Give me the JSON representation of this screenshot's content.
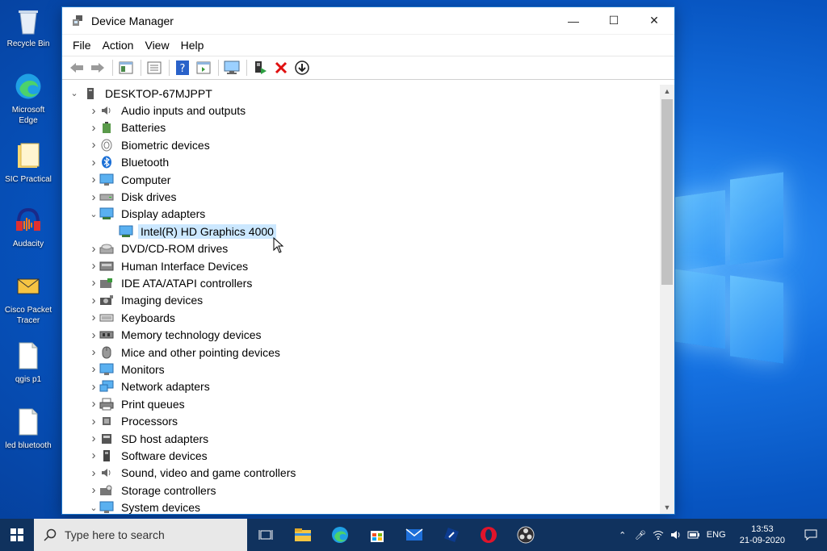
{
  "window": {
    "title": "Device Manager",
    "minimize": "—",
    "maximize": "☐",
    "close": "✕"
  },
  "menu": [
    "File",
    "Action",
    "View",
    "Help"
  ],
  "tree": {
    "root": "DESKTOP-67MJPPT",
    "items": [
      {
        "label": "Audio inputs and outputs",
        "icon": "speaker-icon",
        "expanded": false
      },
      {
        "label": "Batteries",
        "icon": "battery-icon",
        "expanded": false
      },
      {
        "label": "Biometric devices",
        "icon": "fingerprint-icon",
        "expanded": false
      },
      {
        "label": "Bluetooth",
        "icon": "bluetooth-icon",
        "expanded": false
      },
      {
        "label": "Computer",
        "icon": "computer-icon",
        "expanded": false
      },
      {
        "label": "Disk drives",
        "icon": "disk-drive-icon",
        "expanded": false
      },
      {
        "label": "Display adapters",
        "icon": "display-adapter-icon",
        "expanded": true,
        "children": [
          {
            "label": "Intel(R) HD Graphics 4000",
            "icon": "display-adapter-icon",
            "selected": true
          }
        ]
      },
      {
        "label": "DVD/CD-ROM drives",
        "icon": "dvd-icon",
        "expanded": false
      },
      {
        "label": "Human Interface Devices",
        "icon": "hid-icon",
        "expanded": false
      },
      {
        "label": "IDE ATA/ATAPI controllers",
        "icon": "ide-controller-icon",
        "expanded": false
      },
      {
        "label": "Imaging devices",
        "icon": "camera-icon",
        "expanded": false
      },
      {
        "label": "Keyboards",
        "icon": "keyboard-icon",
        "expanded": false
      },
      {
        "label": "Memory technology devices",
        "icon": "memory-icon",
        "expanded": false
      },
      {
        "label": "Mice and other pointing devices",
        "icon": "mouse-icon",
        "expanded": false
      },
      {
        "label": "Monitors",
        "icon": "monitor-icon",
        "expanded": false
      },
      {
        "label": "Network adapters",
        "icon": "network-adapter-icon",
        "expanded": false
      },
      {
        "label": "Print queues",
        "icon": "printer-icon",
        "expanded": false
      },
      {
        "label": "Processors",
        "icon": "processor-icon",
        "expanded": false
      },
      {
        "label": "SD host adapters",
        "icon": "sd-card-icon",
        "expanded": false
      },
      {
        "label": "Software devices",
        "icon": "software-device-icon",
        "expanded": false
      },
      {
        "label": "Sound, video and game controllers",
        "icon": "speaker-icon",
        "expanded": false
      },
      {
        "label": "Storage controllers",
        "icon": "storage-controller-icon",
        "expanded": false
      },
      {
        "label": "System devices",
        "icon": "system-device-icon",
        "expanded": true
      }
    ]
  },
  "desktop_icons": [
    {
      "label": "Recycle Bin",
      "icon": "recycle-bin-icon"
    },
    {
      "label": "Microsoft Edge",
      "icon": "edge-icon"
    },
    {
      "label": "SIC Practical",
      "icon": "folder-icon"
    },
    {
      "label": "Audacity",
      "icon": "audacity-icon"
    },
    {
      "label": "Cisco Packet Tracer",
      "icon": "packet-tracer-icon"
    },
    {
      "label": "qgis p1",
      "icon": "document-icon"
    },
    {
      "label": "led bluetooth",
      "icon": "document-icon"
    }
  ],
  "taskbar": {
    "search_placeholder": "Type here to search",
    "apps": [
      "task-view-icon",
      "file-explorer-icon",
      "edge-icon",
      "store-icon",
      "mail-icon",
      "pen-app-icon",
      "opera-icon",
      "obs-icon"
    ],
    "language": "ENG",
    "time": "13:53",
    "date": "21-09-2020"
  },
  "colors": {
    "selection": "#cce8ff",
    "taskbar": "#10325e",
    "desktop": "#0a5fc4"
  }
}
